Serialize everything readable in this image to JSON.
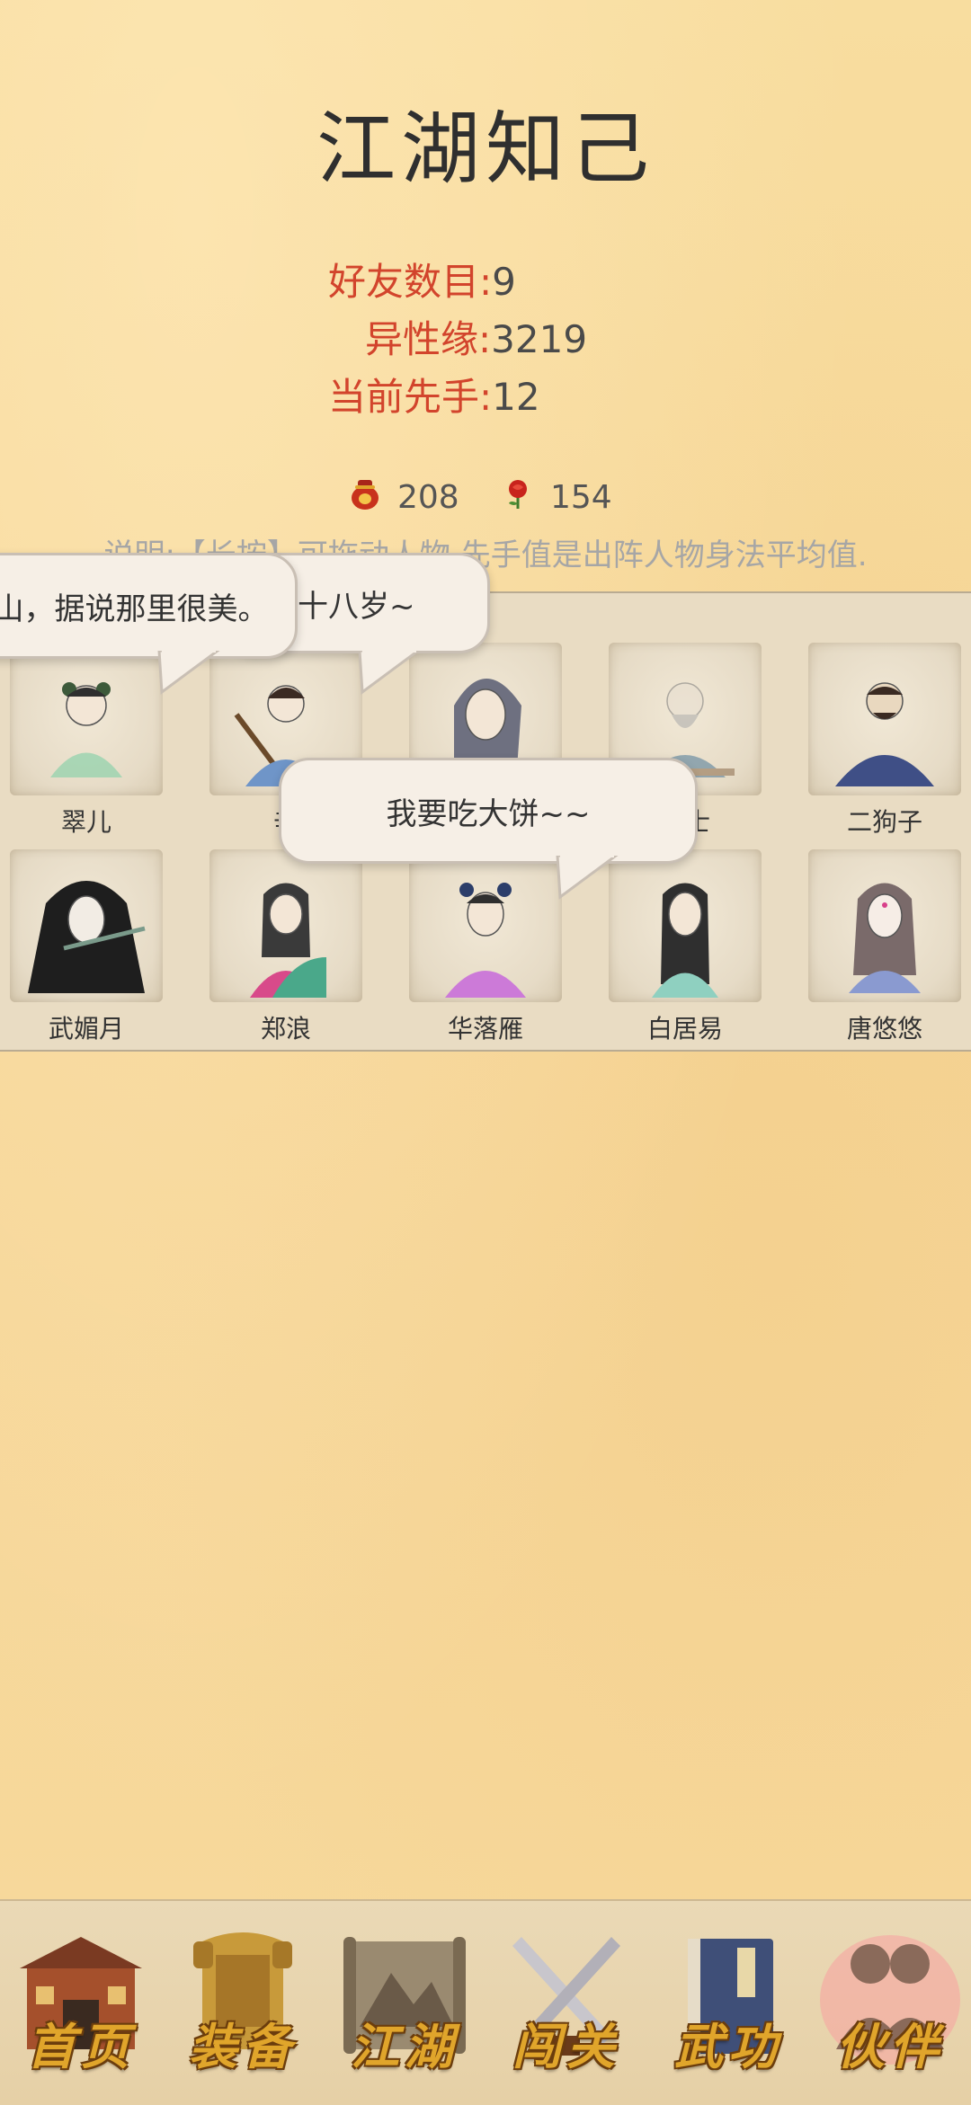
{
  "page": {
    "title": "江湖知己"
  },
  "stats": [
    {
      "label": "好友数目:",
      "value": "9"
    },
    {
      "label": "异性缘:",
      "value": "3219"
    },
    {
      "label": "当前先手:",
      "value": "12"
    }
  ],
  "resources": [
    {
      "icon": "wine-jar-icon",
      "value": "208"
    },
    {
      "icon": "rose-icon",
      "value": "154"
    }
  ],
  "note": "说明:【长按】可拖动人物,先手值是出阵人物身法平均值.",
  "characters": [
    {
      "name": "翠儿"
    },
    {
      "name": "辛"
    },
    {
      "name": ""
    },
    {
      "name": "居士"
    },
    {
      "name": "二狗子"
    },
    {
      "name": "武媚月"
    },
    {
      "name": "郑浪"
    },
    {
      "name": "华落雁"
    },
    {
      "name": "白居易"
    },
    {
      "name": "唐悠悠"
    }
  ],
  "bubbles": [
    {
      "text": "山，据说那里很美。"
    },
    {
      "text": "十八岁~"
    },
    {
      "text": "我要吃大饼~~"
    }
  ],
  "nav": [
    {
      "label": "首页",
      "icon": "house-icon"
    },
    {
      "label": "装备",
      "icon": "armor-icon"
    },
    {
      "label": "江湖",
      "icon": "map-scroll-icon"
    },
    {
      "label": "闯关",
      "icon": "crossed-swords-icon"
    },
    {
      "label": "武功",
      "icon": "martial-book-icon"
    },
    {
      "label": "伙伴",
      "icon": "partners-icon"
    }
  ],
  "colors": {
    "accent_red": "#d2442c",
    "nav_gold": "#e0a52b",
    "background": "#f7d99a"
  }
}
